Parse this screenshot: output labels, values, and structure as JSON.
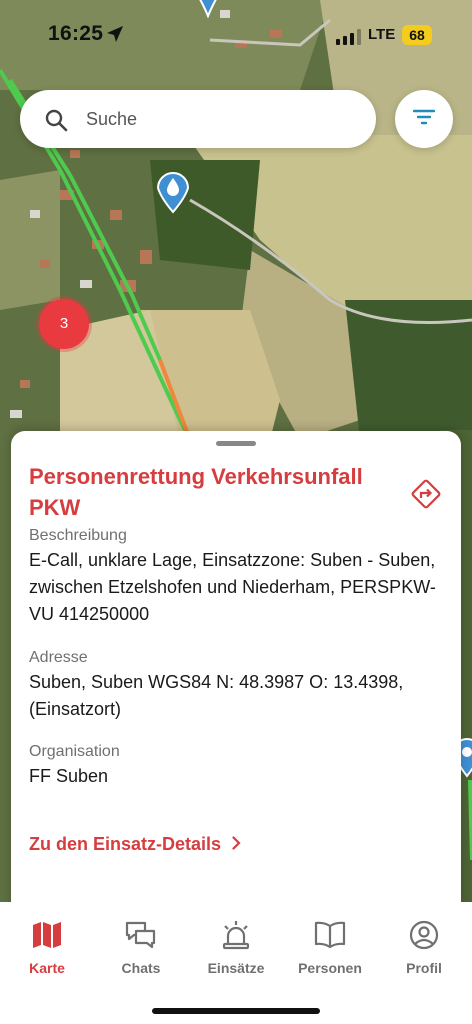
{
  "status_bar": {
    "time": "16:25",
    "network": "LTE",
    "battery": "68"
  },
  "search": {
    "placeholder": "Suche",
    "value": ""
  },
  "map": {
    "cluster_count": "3"
  },
  "incident": {
    "title": "Personenrettung Verkehrsunfall PKW",
    "description_label": "Beschreibung",
    "description": "E-Call, unklare Lage, Einsatzzone: Suben - Suben, zwischen Etzelshofen und Niederham, PERSPKW-VU 414250000",
    "address_label": "Adresse",
    "address": "Suben, Suben WGS84 N: 48.3987 O: 13.4398, (Einsatzort)",
    "organisation_label": "Organisation",
    "organisation": "FF Suben",
    "details_link": "Zu den Einsatz-Details"
  },
  "tabs": [
    {
      "label": "Karte",
      "icon": "map-icon",
      "active": true
    },
    {
      "label": "Chats",
      "icon": "chats-icon",
      "active": false
    },
    {
      "label": "Einsätze",
      "icon": "siren-icon",
      "active": false
    },
    {
      "label": "Personen",
      "icon": "book-icon",
      "active": false
    },
    {
      "label": "Profil",
      "icon": "profile-icon",
      "active": false
    }
  ],
  "colors": {
    "accent": "#d63d3f",
    "marker_blue": "#3f8fd2",
    "cluster_red": "#e83a3f",
    "battery_yellow": "#f5cc1d"
  }
}
